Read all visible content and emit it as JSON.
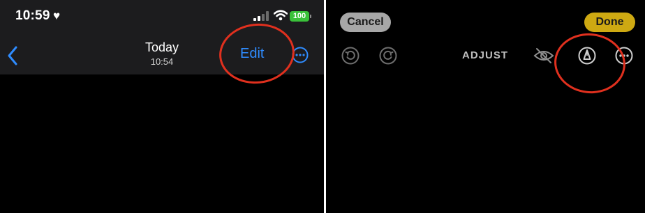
{
  "left_panel": {
    "status_bar": {
      "time": "10:59",
      "battery": "100",
      "battery_color": "#3ac13a"
    },
    "nav": {
      "title": "Today",
      "subtitle": "10:54",
      "edit_label": "Edit",
      "accent_color": "#2f8cff",
      "icons": [
        "back-chevron-icon",
        "more-circle-icon"
      ]
    }
  },
  "right_panel": {
    "cancel_label": "Cancel",
    "done_label": "Done",
    "done_color": "#cea912",
    "toolbar": {
      "mode_label": "ADJUST",
      "icons": [
        "undo-icon",
        "redo-icon",
        "hide-eye-icon",
        "markup-pen-icon",
        "more-circle-icon"
      ]
    }
  },
  "annotation_color": "#e0301e"
}
